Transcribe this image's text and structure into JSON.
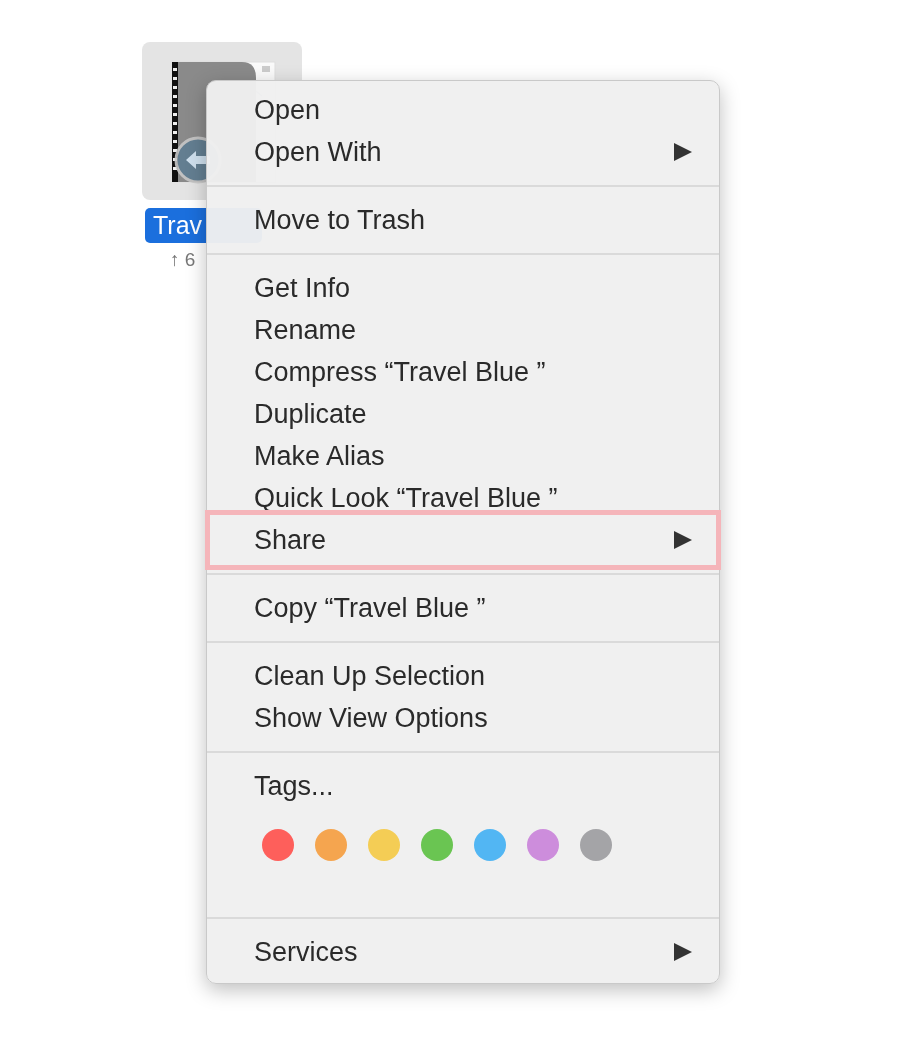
{
  "desktop_item": {
    "name": "Trav",
    "selected": true,
    "detail": "↑ 6"
  },
  "menu": {
    "sections": [
      {
        "items": [
          {
            "label": "Open",
            "submenu": false,
            "highlighted": false
          },
          {
            "label": "Open With",
            "submenu": true,
            "highlighted": false
          }
        ]
      },
      {
        "items": [
          {
            "label": "Move to Trash",
            "submenu": false,
            "highlighted": false
          }
        ]
      },
      {
        "items": [
          {
            "label": "Get Info",
            "submenu": false,
            "highlighted": false
          },
          {
            "label": "Rename",
            "submenu": false,
            "highlighted": false
          },
          {
            "label": "Compress “Travel Blue ”",
            "submenu": false,
            "highlighted": false
          },
          {
            "label": "Duplicate",
            "submenu": false,
            "highlighted": false
          },
          {
            "label": "Make Alias",
            "submenu": false,
            "highlighted": false
          },
          {
            "label": "Quick Look “Travel Blue ”",
            "submenu": false,
            "highlighted": false
          },
          {
            "label": "Share",
            "submenu": true,
            "highlighted": true
          }
        ]
      },
      {
        "items": [
          {
            "label": "Copy “Travel Blue ”",
            "submenu": false,
            "highlighted": false
          }
        ]
      },
      {
        "items": [
          {
            "label": "Clean Up Selection",
            "submenu": false,
            "highlighted": false
          },
          {
            "label": "Show View Options",
            "submenu": false,
            "highlighted": false
          }
        ]
      },
      {
        "items": [
          {
            "label": "Tags...",
            "submenu": false,
            "highlighted": false
          }
        ],
        "tags": [
          {
            "color": "#fe5f5b"
          },
          {
            "color": "#f5a54f"
          },
          {
            "color": "#f4cd55"
          },
          {
            "color": "#6ac552"
          },
          {
            "color": "#52b6f3"
          },
          {
            "color": "#cd8ddc"
          },
          {
            "color": "#a4a4a7"
          }
        ]
      },
      {
        "items": [
          {
            "label": "Services",
            "submenu": true,
            "highlighted": false
          }
        ]
      }
    ]
  }
}
